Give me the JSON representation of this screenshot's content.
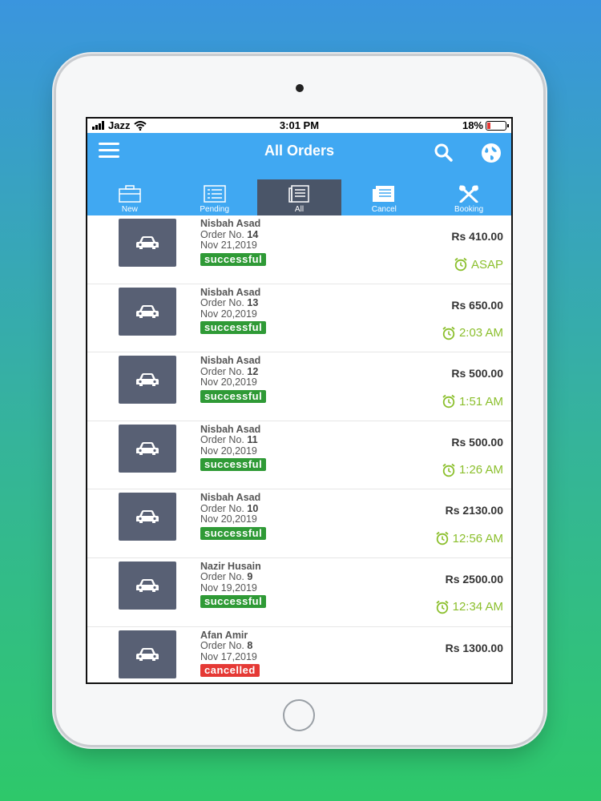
{
  "status_bar": {
    "carrier": "Jazz",
    "time": "3:01 PM",
    "battery": "18%",
    "battery_level": 0.18
  },
  "header": {
    "title": "All Orders"
  },
  "tabs": [
    {
      "label": "New",
      "icon": "briefcase-icon"
    },
    {
      "label": "Pending",
      "icon": "list-icon"
    },
    {
      "label": "All",
      "icon": "document-icon",
      "active": true
    },
    {
      "label": "Cancel",
      "icon": "newspaper-icon"
    },
    {
      "label": "Booking",
      "icon": "fork-spoon-icon"
    }
  ],
  "orders": [
    {
      "customer": "Nisbah Asad",
      "order_prefix": "Order No.",
      "order_no": "14",
      "date": "Nov 21,2019",
      "status": "successful",
      "price": "Rs 410.00",
      "time": "ASAP"
    },
    {
      "customer": "Nisbah Asad",
      "order_prefix": "Order No.",
      "order_no": "13",
      "date": "Nov 20,2019",
      "status": "successful",
      "price": "Rs 650.00",
      "time": "2:03 AM"
    },
    {
      "customer": "Nisbah Asad",
      "order_prefix": "Order No.",
      "order_no": "12",
      "date": "Nov 20,2019",
      "status": "successful",
      "price": "Rs 500.00",
      "time": "1:51 AM"
    },
    {
      "customer": "Nisbah Asad",
      "order_prefix": "Order No.",
      "order_no": "11",
      "date": "Nov 20,2019",
      "status": "successful",
      "price": "Rs 500.00",
      "time": "1:26 AM"
    },
    {
      "customer": "Nisbah Asad",
      "order_prefix": "Order No.",
      "order_no": "10",
      "date": "Nov 20,2019",
      "status": "successful",
      "price": "Rs 2130.00",
      "time": "12:56 AM"
    },
    {
      "customer": "Nazir Husain",
      "order_prefix": "Order No.",
      "order_no": "9",
      "date": "Nov 19,2019",
      "status": "successful",
      "price": "Rs 2500.00",
      "time": "12:34 AM"
    },
    {
      "customer": "Afan Amir",
      "order_prefix": "Order No.",
      "order_no": "8",
      "date": "Nov 17,2019",
      "status": "cancelled",
      "price": "Rs 1300.00",
      "time": ""
    }
  ],
  "colors": {
    "accent": "#40a8f2",
    "active_tab": "#4a5568",
    "success": "#2f9a36",
    "cancelled": "#e53935",
    "time": "#8bbf2c"
  }
}
